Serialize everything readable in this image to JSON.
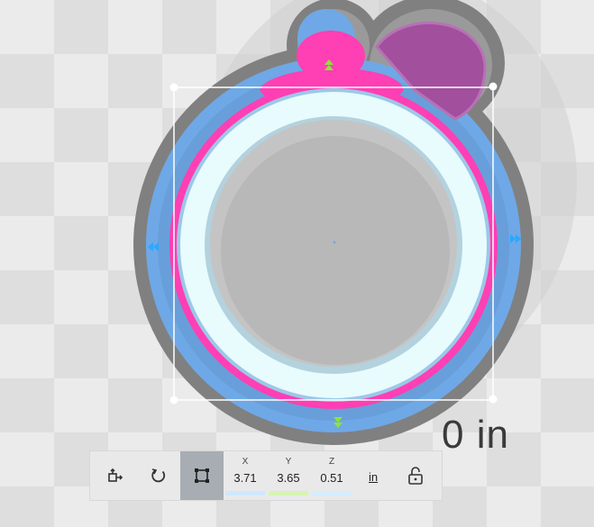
{
  "viewport": {
    "dimension_readout": "0 in",
    "colors": {
      "pink": "#ff3fb4",
      "blue": "#6fa8e6",
      "purple": "#a24f9e",
      "gray": "#7c7c7c",
      "green": "#8fe23a"
    }
  },
  "toolbar": {
    "tools": [
      {
        "name": "move-tool",
        "icon": "move-icon",
        "active": false
      },
      {
        "name": "rotate-tool",
        "icon": "rotate-icon",
        "active": false
      },
      {
        "name": "scale-tool",
        "icon": "scale-icon",
        "active": true
      }
    ],
    "coords": {
      "x_label": "X",
      "x_value": "3.71",
      "x_color": "#cfe8ff",
      "y_label": "Y",
      "y_value": "3.65",
      "y_color": "#d7f5b0",
      "z_label": "Z",
      "z_value": "0.51",
      "z_color": "#d6ecff"
    },
    "unit_label": "in",
    "lock_icon": "unlock-icon"
  }
}
